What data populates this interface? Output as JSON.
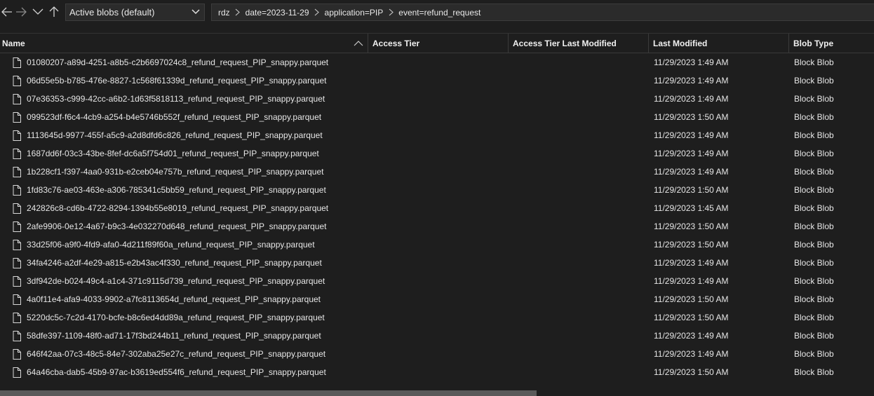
{
  "toolbar": {
    "back_icon": "arrow-left-icon",
    "forward_icon": "arrow-right-icon",
    "recent_icon": "chevron-down-icon",
    "up_icon": "arrow-up-icon",
    "filter_selected": "Active blobs (default)"
  },
  "breadcrumb": [
    "rdz",
    "date=2023-11-29",
    "application=PIP",
    "event=refund_request"
  ],
  "columns": {
    "name": "Name",
    "access_tier": "Access Tier",
    "access_tier_last_modified": "Access Tier Last Modified",
    "last_modified": "Last Modified",
    "blob_type": "Blob Type"
  },
  "rows": [
    {
      "name": "01080207-a89d-4251-a8b5-c2b6697024c8_refund_request_PIP_snappy.parquet",
      "access_tier": "",
      "access_tier_last_modified": "",
      "last_modified": "11/29/2023 1:49 AM",
      "blob_type": "Block Blob"
    },
    {
      "name": "06d55e5b-b785-476e-8827-1c568f61339d_refund_request_PIP_snappy.parquet",
      "access_tier": "",
      "access_tier_last_modified": "",
      "last_modified": "11/29/2023 1:49 AM",
      "blob_type": "Block Blob"
    },
    {
      "name": "07e36353-c999-42cc-a6b2-1d63f5818113_refund_request_PIP_snappy.parquet",
      "access_tier": "",
      "access_tier_last_modified": "",
      "last_modified": "11/29/2023 1:49 AM",
      "blob_type": "Block Blob"
    },
    {
      "name": "099523df-f6c4-4cb9-a254-b4e5746b552f_refund_request_PIP_snappy.parquet",
      "access_tier": "",
      "access_tier_last_modified": "",
      "last_modified": "11/29/2023 1:50 AM",
      "blob_type": "Block Blob"
    },
    {
      "name": "1113645d-9977-455f-a5c9-a2d8dfd6c826_refund_request_PIP_snappy.parquet",
      "access_tier": "",
      "access_tier_last_modified": "",
      "last_modified": "11/29/2023 1:49 AM",
      "blob_type": "Block Blob"
    },
    {
      "name": "1687dd6f-03c3-43be-8fef-dc6a5f754d01_refund_request_PIP_snappy.parquet",
      "access_tier": "",
      "access_tier_last_modified": "",
      "last_modified": "11/29/2023 1:49 AM",
      "blob_type": "Block Blob"
    },
    {
      "name": "1b228cf1-f397-4aa0-931b-e2ceb04e757b_refund_request_PIP_snappy.parquet",
      "access_tier": "",
      "access_tier_last_modified": "",
      "last_modified": "11/29/2023 1:49 AM",
      "blob_type": "Block Blob"
    },
    {
      "name": "1fd83c76-ae03-463e-a306-785341c5bb59_refund_request_PIP_snappy.parquet",
      "access_tier": "",
      "access_tier_last_modified": "",
      "last_modified": "11/29/2023 1:50 AM",
      "blob_type": "Block Blob"
    },
    {
      "name": "242826c8-cd6b-4722-8294-1394b55e8019_refund_request_PIP_snappy.parquet",
      "access_tier": "",
      "access_tier_last_modified": "",
      "last_modified": "11/29/2023 1:45 AM",
      "blob_type": "Block Blob"
    },
    {
      "name": "2afe9906-0e12-4a67-b9c3-4e032270d648_refund_request_PIP_snappy.parquet",
      "access_tier": "",
      "access_tier_last_modified": "",
      "last_modified": "11/29/2023 1:50 AM",
      "blob_type": "Block Blob"
    },
    {
      "name": "33d25f06-a9f0-4fd9-afa0-4d211f89f60a_refund_request_PIP_snappy.parquet",
      "access_tier": "",
      "access_tier_last_modified": "",
      "last_modified": "11/29/2023 1:50 AM",
      "blob_type": "Block Blob"
    },
    {
      "name": "34fa4246-a2df-4e29-a815-e2b43ac4f330_refund_request_PIP_snappy.parquet",
      "access_tier": "",
      "access_tier_last_modified": "",
      "last_modified": "11/29/2023 1:49 AM",
      "blob_type": "Block Blob"
    },
    {
      "name": "3df942de-b024-49c4-a1c4-371c9115d739_refund_request_PIP_snappy.parquet",
      "access_tier": "",
      "access_tier_last_modified": "",
      "last_modified": "11/29/2023 1:49 AM",
      "blob_type": "Block Blob"
    },
    {
      "name": "4a0f11e4-afa9-4033-9902-a7fc8113654d_refund_request_PIP_snappy.parquet",
      "access_tier": "",
      "access_tier_last_modified": "",
      "last_modified": "11/29/2023 1:50 AM",
      "blob_type": "Block Blob"
    },
    {
      "name": "5220dc5c-7c2d-4170-bcfe-b8c6ed4dd89a_refund_request_PIP_snappy.parquet",
      "access_tier": "",
      "access_tier_last_modified": "",
      "last_modified": "11/29/2023 1:50 AM",
      "blob_type": "Block Blob"
    },
    {
      "name": "58dfe397-1109-48f0-ad71-17f3bd244b11_refund_request_PIP_snappy.parquet",
      "access_tier": "",
      "access_tier_last_modified": "",
      "last_modified": "11/29/2023 1:49 AM",
      "blob_type": "Block Blob"
    },
    {
      "name": "646f42aa-07c3-48c5-84e7-302aba25e27c_refund_request_PIP_snappy.parquet",
      "access_tier": "",
      "access_tier_last_modified": "",
      "last_modified": "11/29/2023 1:49 AM",
      "blob_type": "Block Blob"
    },
    {
      "name": "64a46cba-dab5-45b9-97ac-b3619ed554f6_refund_request_PIP_snappy.parquet",
      "access_tier": "",
      "access_tier_last_modified": "",
      "last_modified": "11/29/2023 1:50 AM",
      "blob_type": "Block Blob"
    }
  ],
  "file_icon": "file-icon",
  "sort_icon": "chevron-up-icon"
}
